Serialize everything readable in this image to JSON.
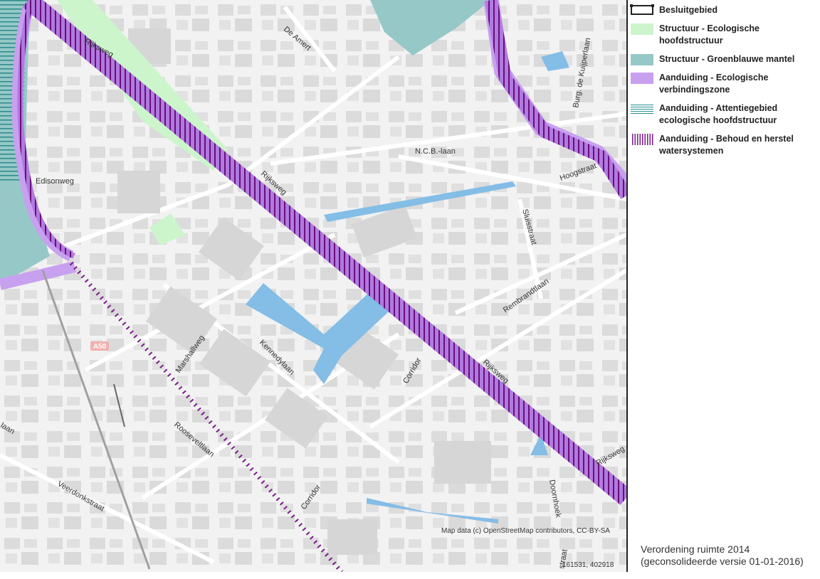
{
  "legend": {
    "items": [
      {
        "label": "Besluitgebied",
        "swatch": "besluit"
      },
      {
        "label": "Structuur - Ecologische hoofdstructuur",
        "swatch": "ehs",
        "color": "#ccf5cc"
      },
      {
        "label": "Structuur - Groenblauwe mantel",
        "swatch": "gbm",
        "color": "#96c8c8"
      },
      {
        "label": "Aanduiding - Ecologische verbindingszone",
        "swatch": "evz",
        "color": "#c8a0f0"
      },
      {
        "label": "Aanduiding - Attentiegebied ecologische hoofdstructuur",
        "swatch": "att",
        "color": "#2a9090"
      },
      {
        "label": "Aanduiding - Behoud en herstel watersystemen",
        "swatch": "behoud",
        "color": "#7a1a8a"
      }
    ]
  },
  "map": {
    "attribution": "Map data (c) OpenStreetMap contributors, CC-BY-SA",
    "coordinates": "161531, 402918",
    "street_labels": {
      "rijksweg_1": "Rijksweg",
      "rijksweg_2": "Rijksweg",
      "rijksweg_3": "Rijksweg",
      "rijksweg_4": "Rijksweg",
      "de_amert": "De Amert",
      "ncb_laan": "N.C.B.-laan",
      "hoogstraat": "Hoogstraat",
      "burg_kuijperlaan": "Burg. de Kuijperlaan",
      "edisonweg": "Edisonweg",
      "sluisstraat": "Sluisstraat",
      "rembrandtlaan": "Rembrandtlaan",
      "marshallweg": "Marshallweg",
      "kennedylaan": "Kennedylaan",
      "corridor_1": "Corridor",
      "corridor_2": "Corridor",
      "a50": "A50",
      "veerdonkstraat": "Veerdonkstraat",
      "doornhoek": "Doornhoek",
      "laan_left": "laan",
      "straat_bottom": "straat",
      "rooseveltlaan": "Rooseveltlaan"
    }
  },
  "footer": {
    "line1": "Verordening ruimte 2014",
    "line2": "(geconsolideerde versie 01-01-2016)"
  }
}
